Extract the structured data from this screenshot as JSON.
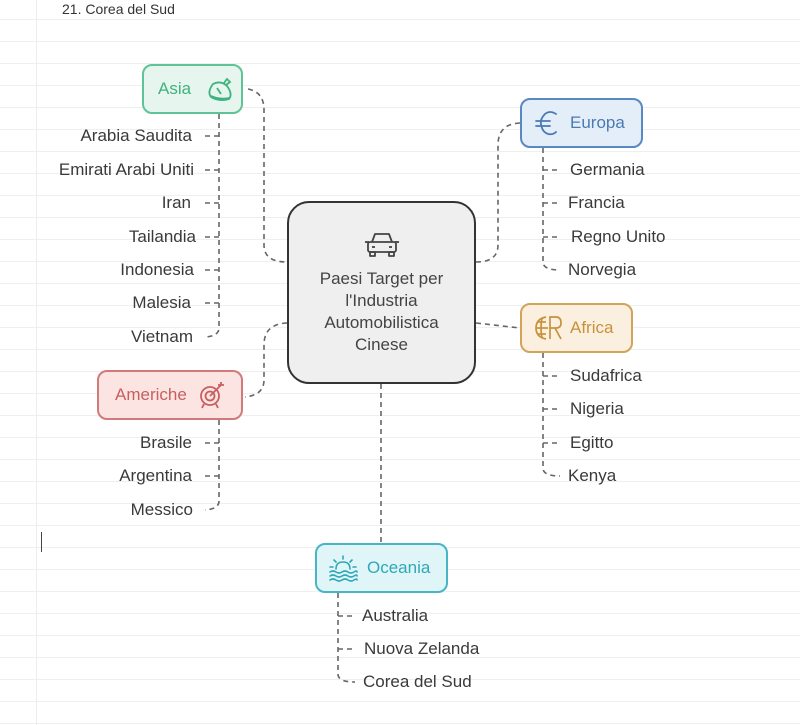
{
  "header_text": "21. Corea del Sud",
  "center": {
    "icon": "car-icon",
    "title": "Paesi Target per l'Industria Automobilistica Cinese"
  },
  "colors": {
    "asia": "#3fb27f",
    "europa": "#4a7ab5",
    "africa": "#c8923c",
    "americhe": "#c85f5f",
    "oceania": "#2fa8b8"
  },
  "branches": {
    "asia": {
      "label": "Asia",
      "icon": "geography-map-icon",
      "items": [
        "Arabia Saudita",
        "Emirati Arabi Uniti",
        "Iran",
        "Tailandia",
        "Indonesia",
        "Malesia",
        "Vietnam"
      ]
    },
    "europa": {
      "label": "Europa",
      "icon": "euro-icon",
      "items": [
        "Germania",
        "Francia",
        "Regno Unito",
        "Norvegia"
      ]
    },
    "africa": {
      "label": "Africa",
      "icon": "globe-currency-icon",
      "items": [
        "Sudafrica",
        "Nigeria",
        "Egitto",
        "Kenya"
      ]
    },
    "americhe": {
      "label": "Americhe",
      "icon": "target-icon",
      "items": [
        "Brasile",
        "Argentina",
        "Messico"
      ]
    },
    "oceania": {
      "label": "Oceania",
      "icon": "sun-waves-icon",
      "items": [
        "Australia",
        "Nuova Zelanda",
        "Corea del Sud"
      ]
    }
  }
}
